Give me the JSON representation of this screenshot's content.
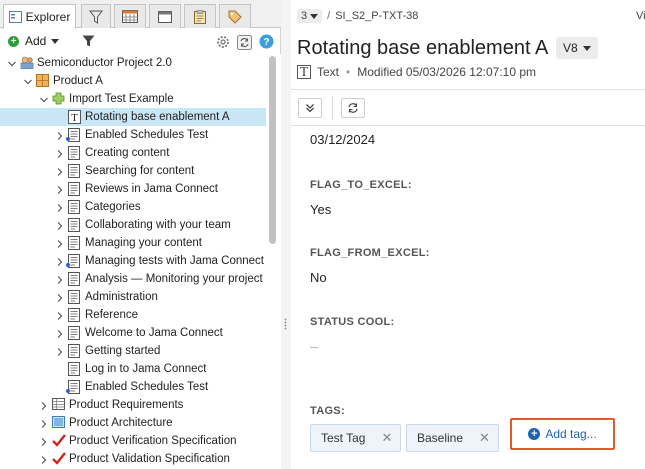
{
  "explorer": {
    "tab_label": "Explorer",
    "add_label": "Add",
    "tabs": [
      {
        "icon": "explorer-icon"
      },
      {
        "icon": "filter-icon"
      },
      {
        "icon": "calendar-grid-icon"
      },
      {
        "icon": "window-icon"
      },
      {
        "icon": "clipboard-icon"
      },
      {
        "icon": "tag-icon"
      }
    ]
  },
  "tree": {
    "items": [
      {
        "label": "Semiconductor Project 2.0",
        "level": 0,
        "expanded": true,
        "icon": "project-icon"
      },
      {
        "label": "Product A",
        "level": 1,
        "expanded": true,
        "icon": "component-icon"
      },
      {
        "label": "Import Test Example",
        "level": 2,
        "expanded": true,
        "icon": "set-icon"
      },
      {
        "label": "Rotating base enablement A",
        "level": 3,
        "icon": "text-item-icon",
        "selected": true,
        "leaf": true
      },
      {
        "label": "Enabled Schedules Test",
        "level": 3,
        "icon": "doc-icon",
        "badge": true
      },
      {
        "label": "Creating content",
        "level": 3,
        "icon": "doc-icon"
      },
      {
        "label": "Searching for content",
        "level": 3,
        "icon": "doc-icon"
      },
      {
        "label": "Reviews in Jama Connect",
        "level": 3,
        "icon": "doc-icon"
      },
      {
        "label": "Categories",
        "level": 3,
        "icon": "doc-icon"
      },
      {
        "label": "Collaborating with your team",
        "level": 3,
        "icon": "doc-icon"
      },
      {
        "label": "Managing your content",
        "level": 3,
        "icon": "doc-icon"
      },
      {
        "label": "Managing tests with Jama Connect",
        "level": 3,
        "icon": "doc-icon",
        "badge": true
      },
      {
        "label": "Analysis — Monitoring your project",
        "level": 3,
        "icon": "doc-icon"
      },
      {
        "label": "Administration",
        "level": 3,
        "icon": "doc-icon"
      },
      {
        "label": "Reference",
        "level": 3,
        "icon": "doc-icon"
      },
      {
        "label": "Welcome to Jama Connect",
        "level": 3,
        "icon": "doc-icon"
      },
      {
        "label": "Getting started",
        "level": 3,
        "icon": "doc-icon"
      },
      {
        "label": "Log in to Jama Connect",
        "level": 3,
        "icon": "doc-icon",
        "leaf": true
      },
      {
        "label": "Enabled Schedules Test",
        "level": 3,
        "icon": "doc-icon",
        "badge": true,
        "leaf": true
      },
      {
        "label": "Product Requirements",
        "level": 2,
        "icon": "table-icon"
      },
      {
        "label": "Product Architecture",
        "level": 2,
        "icon": "image-icon"
      },
      {
        "label": "Product Verification Specification",
        "level": 2,
        "icon": "check-icon"
      },
      {
        "label": "Product Validation Specification",
        "level": 2,
        "icon": "check-icon"
      }
    ]
  },
  "detail": {
    "count": "3",
    "breadcrumb": "SI_S2_P-TXT-38",
    "truncated": "Vi",
    "title": "Rotating base enablement A",
    "version": "V8",
    "item_type": "Text",
    "modified": "Modified 05/03/2026 12:07:10 pm",
    "fields": [
      {
        "label": "",
        "value": "03/12/2024"
      },
      {
        "label": "FLAG_TO_EXCEL:",
        "value": "Yes"
      },
      {
        "label": "FLAG_FROM_EXCEL:",
        "value": "No"
      },
      {
        "label": "STATUS COOL:",
        "value": ""
      }
    ],
    "tags_label": "TAGS:",
    "tags": [
      "Test Tag",
      "Baseline"
    ],
    "add_tag": "Add tag..."
  }
}
